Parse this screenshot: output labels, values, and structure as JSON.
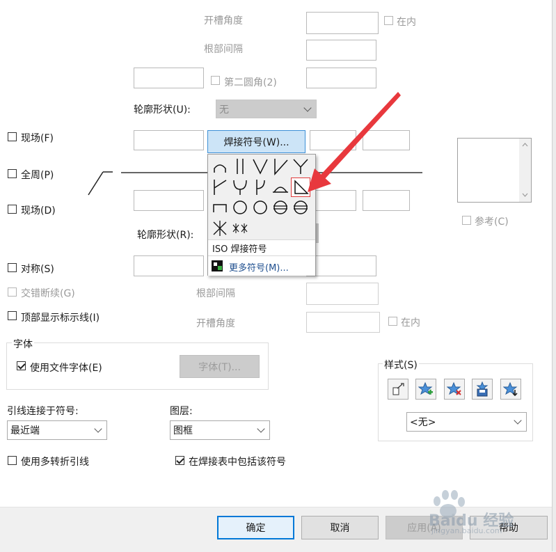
{
  "top_section": {
    "groove_angle_label": "开槽角度",
    "inside_label": "在内",
    "root_gap_label": "根部间隔",
    "second_fillet_label": "第二圆角(2)",
    "contour_shape_upper_label": "轮廓形状(U):",
    "contour_shape_upper_value": "无",
    "weld_symbol_button": "焊接符号(W)..."
  },
  "left_options": {
    "field_upper": "现场(F)",
    "all_around": "全周(P)",
    "field_lower": "现场(D)",
    "symmetric": "对称(S)",
    "staggered": "交错断续(G)",
    "show_top_line": "顶部显示标示线(I)"
  },
  "popup": {
    "iso_label": "ISO 焊接符号",
    "more_symbols_label": "更多符号(M)..."
  },
  "reference_label": "参考(C)",
  "bottom_section": {
    "contour_shape_lower_label": "轮廓形状(R):",
    "root_gap_label": "根部间隔",
    "groove_angle_label": "开槽角度",
    "inside_label": "在内"
  },
  "font_group": {
    "title": "字体",
    "use_doc_font": "使用文件字体(E)",
    "font_button": "字体(T)..."
  },
  "leader": {
    "label": "引线连接于符号:",
    "value": "最近端"
  },
  "layer": {
    "label": "图层:",
    "value": "图框"
  },
  "style_group": {
    "title": "样式(S)",
    "value": "<无>"
  },
  "multi_jog": "使用多转折引线",
  "include_in_table": "在焊接表中包括该符号",
  "footer": {
    "ok": "确定",
    "cancel": "取消",
    "apply": "应用(A)",
    "help": "帮助"
  },
  "watermark": {
    "brand": "Baidu 经验",
    "url": "jingyan.baidu.com"
  },
  "colors": {
    "arrow": "#e8383d",
    "highlight": "#cce4f7",
    "highlight_border": "#7eb4ea"
  }
}
